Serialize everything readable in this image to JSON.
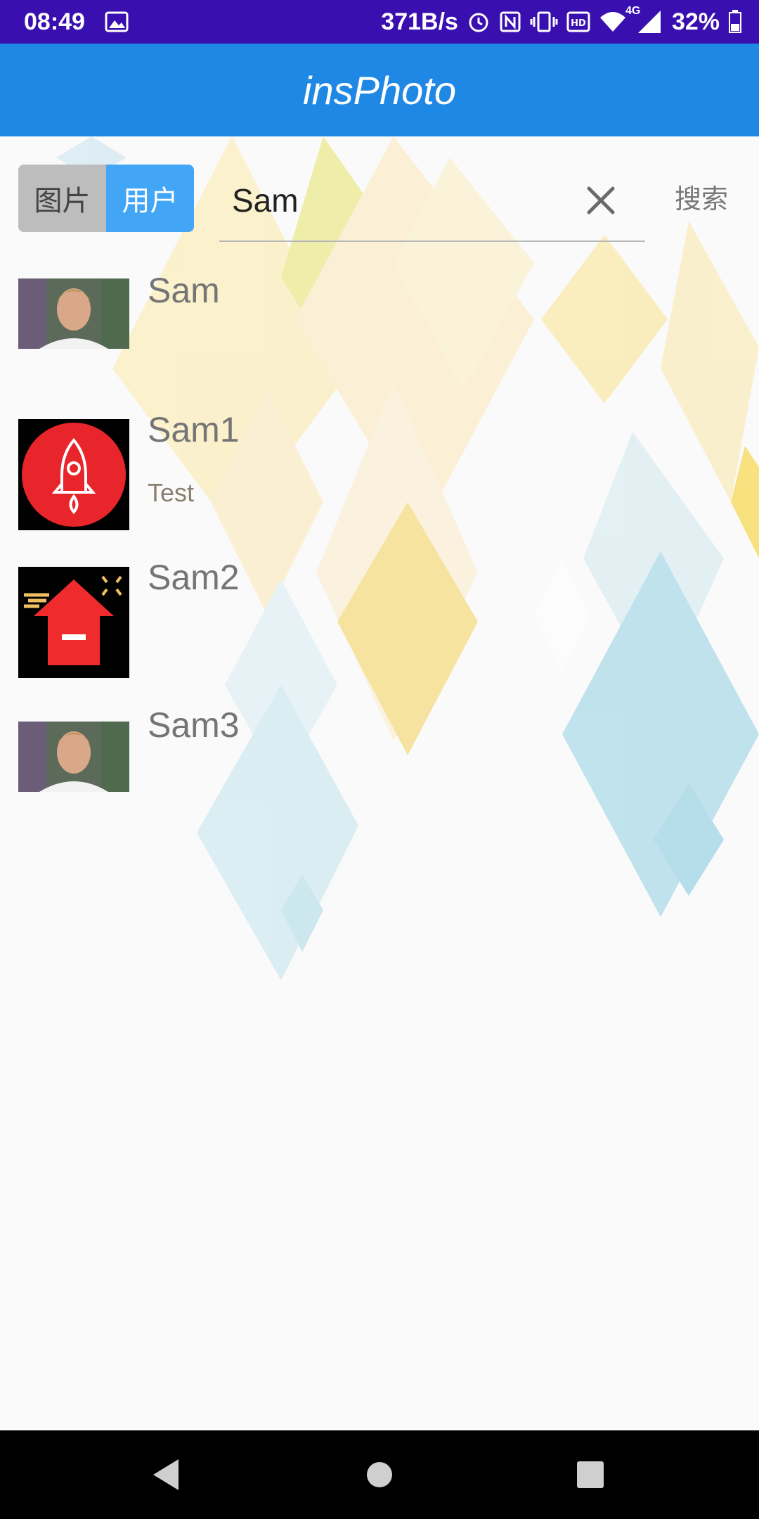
{
  "status_bar": {
    "time": "08:49",
    "network_speed": "371B/s",
    "battery": "32%",
    "network_type": "4G",
    "icons": [
      "image-icon",
      "alarm-icon",
      "nfc-icon",
      "vibrate-icon",
      "hd-icon",
      "wifi-icon",
      "signal-icon",
      "battery-icon"
    ]
  },
  "app_bar": {
    "title": "insPhoto"
  },
  "search": {
    "toggle": {
      "photos_label": "图片",
      "users_label": "用户",
      "selected": "users"
    },
    "query": "Sam",
    "search_label": "搜索"
  },
  "users": [
    {
      "name": "Sam",
      "bio": "",
      "avatar": "portrait-photo"
    },
    {
      "name": "Sam1",
      "bio": "Test",
      "avatar": "rocket-icon"
    },
    {
      "name": "Sam2",
      "bio": "",
      "avatar": "house-icon"
    },
    {
      "name": "Sam3",
      "bio": "",
      "avatar": "portrait-photo"
    }
  ],
  "colors": {
    "status_bar": "#3a0fb0",
    "app_bar": "#1f88e5",
    "toggle_selected": "#42a5f5",
    "toggle_unselected": "#bdbdbd"
  },
  "nav_bar": {
    "icons": [
      "back-icon",
      "home-icon",
      "recents-icon"
    ]
  }
}
